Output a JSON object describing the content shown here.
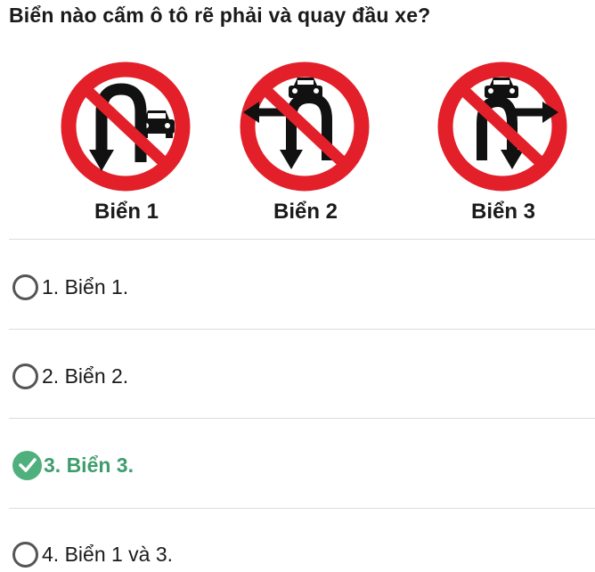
{
  "question": "Biển nào cấm ô tô rẽ phải và quay đầu xe?",
  "signs": [
    {
      "label": "Biển 1",
      "icon": "no-u-turn-for-cars-icon"
    },
    {
      "label": "Biển 2",
      "icon": "no-left-turn-and-u-turn-for-cars-icon"
    },
    {
      "label": "Biển 3",
      "icon": "no-right-turn-and-u-turn-for-cars-icon"
    }
  ],
  "options": [
    {
      "text": "1. Biển 1.",
      "selected": false
    },
    {
      "text": "2. Biển 2.",
      "selected": false
    },
    {
      "text": "3. Biển 3.",
      "selected": true
    },
    {
      "text": "4. Biển 1 và 3.",
      "selected": false
    }
  ],
  "colors": {
    "sign_red": "#e3202a",
    "correct_green": "#4fb07e",
    "correct_text": "#3d9e6c"
  }
}
